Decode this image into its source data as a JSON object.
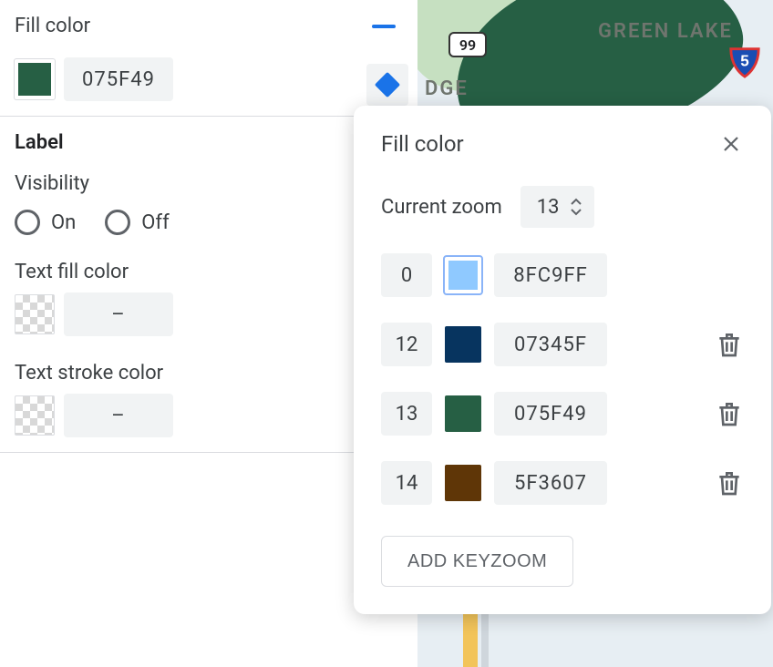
{
  "leftPanel": {
    "fillColor": {
      "title": "Fill color",
      "swatch": "#265f44",
      "hex": "075F49"
    },
    "label": {
      "heading": "Label",
      "visibilityLabel": "Visibility",
      "onLabel": "On",
      "offLabel": "Off",
      "textFillLabel": "Text fill color",
      "textFillValue": "–",
      "textStrokeLabel": "Text stroke color",
      "textStrokeValue": "–"
    }
  },
  "map": {
    "greenLake": "GREEN LAKE",
    "ridgeFragment": "DGE",
    "hwy99": "99",
    "i5": "5"
  },
  "popover": {
    "title": "Fill color",
    "zoomLabel": "Current zoom",
    "zoomValue": "13",
    "keyzooms": [
      {
        "zoom": "0",
        "color": "#8FC9FF",
        "hex": "8FC9FF",
        "deletable": false,
        "highlight": true
      },
      {
        "zoom": "12",
        "color": "#07345F",
        "hex": "07345F",
        "deletable": true,
        "highlight": false
      },
      {
        "zoom": "13",
        "color": "#265f44",
        "hex": "075F49",
        "deletable": true,
        "highlight": false
      },
      {
        "zoom": "14",
        "color": "#5F3607",
        "hex": "5F3607",
        "deletable": true,
        "highlight": false
      }
    ],
    "addLabel": "ADD KEYZOOM"
  }
}
